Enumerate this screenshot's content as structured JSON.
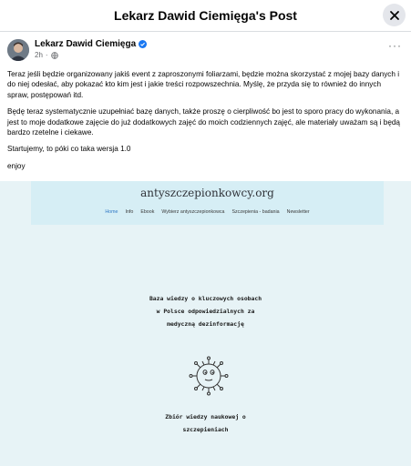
{
  "header": {
    "title": "Lekarz Dawid Ciemięga's Post"
  },
  "post": {
    "author": "Lekarz Dawid Ciemięga",
    "time": "2h",
    "dot": "·",
    "more": "···",
    "paragraphs": [
      "Teraz jeśli będzie organizowany jakiś event z zaproszonymi foliarzami, będzie można skorzystać z mojej bazy danych i do niej odesłać, aby pokazać kto kim jest i jakie treści rozpowszechnia.  Myślę, że przyda się to również do innych spraw, postępowań itd.",
      "Będę teraz systematycznie uzupełniać bazę danych, także proszę o cierpliwość bo jest to sporo pracy do wykonania, a jest to moje dodatkowe zajęcie do już dodatkowych zajęć do moich codziennych zajęć, ale materiały uważam są i będą bardzo rzetelne i ciekawe.",
      "Startujemy, to póki co taka wersja 1.0",
      "enjoy"
    ]
  },
  "media": {
    "site_title": "antyszczepionkowcy.org",
    "nav": [
      "Home",
      "Info",
      "Ebook",
      "Wybierz antyszczepionkowca",
      "Szczepienia - badania",
      "Newsletter"
    ],
    "block1": [
      "Baza wiedzy o kluczowych osobach",
      "w Polsce odpowiedzialnych za",
      "medyczną dezinformację"
    ],
    "block2": [
      "Zbiór wiedzy naukowej o",
      "szczepieniach"
    ]
  },
  "colors": {
    "brand_blue": "#1877f2",
    "site_header_bg": "#d6eef5",
    "media_bg": "#e7f3f6",
    "nav_active": "#2f78c4"
  }
}
